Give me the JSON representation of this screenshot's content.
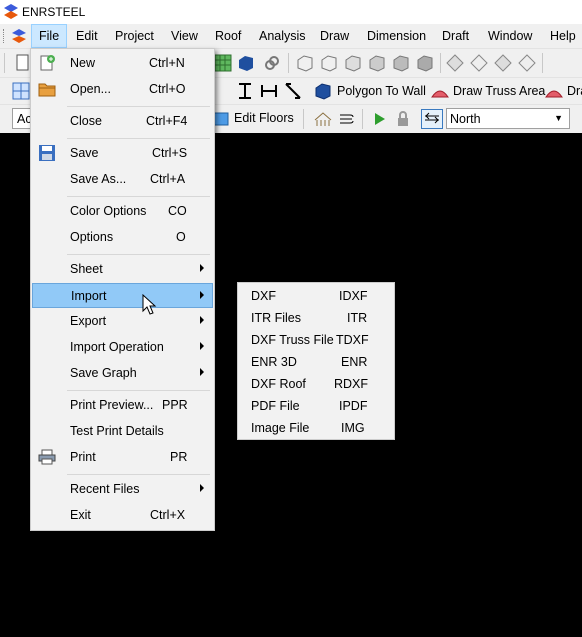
{
  "window": {
    "title": "ENRSTEEL"
  },
  "menubar": {
    "items": [
      "File",
      "Edit",
      "Project",
      "View",
      "Roof",
      "Analysis",
      "Draw",
      "Dimension",
      "Draft",
      "Window",
      "Help"
    ]
  },
  "toolbar2": {
    "polygon_to_wall": "Polygon To Wall",
    "draw_truss_area": "Draw Truss Area",
    "draw_clipped": "Dra"
  },
  "toolbar3": {
    "combo_left": "Ac",
    "edit_floors": "Edit Floors",
    "direction_select": "North"
  },
  "file_menu": {
    "new": {
      "label": "New",
      "shortcut": "Ctrl+N"
    },
    "open": {
      "label": "Open...",
      "shortcut": "Ctrl+O"
    },
    "close": {
      "label": "Close",
      "shortcut": "Ctrl+F4"
    },
    "save": {
      "label": "Save",
      "shortcut": "Ctrl+S"
    },
    "save_as": {
      "label": "Save As...",
      "shortcut": "Ctrl+A"
    },
    "color_options": {
      "label": "Color Options",
      "shortcut": "CO"
    },
    "options": {
      "label": "Options",
      "shortcut": "O"
    },
    "sheet": {
      "label": "Sheet"
    },
    "import": {
      "label": "Import"
    },
    "export": {
      "label": "Export"
    },
    "import_operation": {
      "label": "Import Operation"
    },
    "save_graph": {
      "label": "Save Graph"
    },
    "print_preview": {
      "label": "Print Preview...",
      "shortcut": "PPR"
    },
    "test_print_details": {
      "label": "Test Print Details"
    },
    "print": {
      "label": "Print",
      "shortcut": "PR"
    },
    "recent_files": {
      "label": "Recent Files"
    },
    "exit": {
      "label": "Exit",
      "shortcut": "Ctrl+X"
    }
  },
  "import_submenu": [
    {
      "label": "DXF",
      "shortcut": "IDXF"
    },
    {
      "label": "ITR Files",
      "shortcut": "ITR"
    },
    {
      "label": "DXF Truss File",
      "shortcut": "TDXF"
    },
    {
      "label": "ENR 3D",
      "shortcut": "ENR"
    },
    {
      "label": "DXF Roof",
      "shortcut": "RDXF"
    },
    {
      "label": "PDF File",
      "shortcut": "IPDF"
    },
    {
      "label": "Image File",
      "shortcut": "IMG"
    }
  ],
  "colors": {
    "highlight": "#91c9f7",
    "menubar_active": "#cce8ff",
    "canvas": "#000000"
  }
}
